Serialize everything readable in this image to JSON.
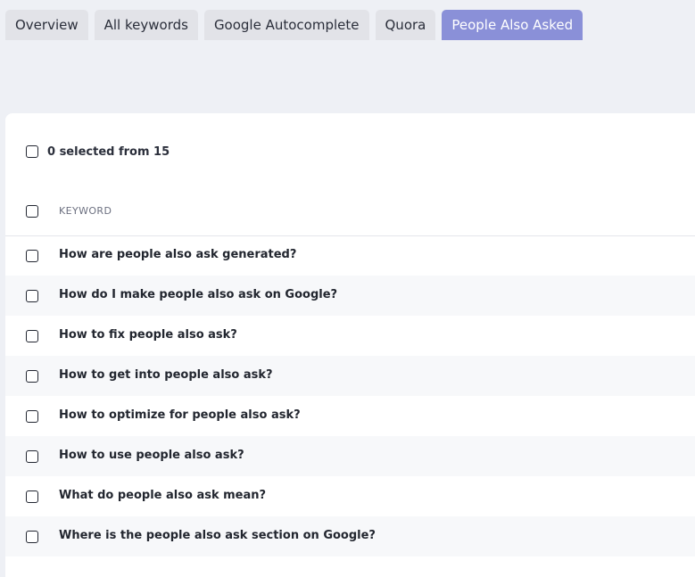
{
  "tabs": [
    {
      "label": "Overview",
      "active": false
    },
    {
      "label": "All keywords",
      "active": false
    },
    {
      "label": "Google Autocomplete",
      "active": false
    },
    {
      "label": "Quora",
      "active": false
    },
    {
      "label": "People Also Asked",
      "active": true
    }
  ],
  "selection": {
    "summary": "0 selected from 15",
    "selected_count": 0,
    "total": 15
  },
  "table": {
    "column_header": "KEYWORD",
    "rows": [
      {
        "keyword": "How are people also ask generated?",
        "checked": false
      },
      {
        "keyword": "How do I make people also ask on Google?",
        "checked": false
      },
      {
        "keyword": "How to fix people also ask?",
        "checked": false
      },
      {
        "keyword": "How to get into people also ask?",
        "checked": false
      },
      {
        "keyword": "How to optimize for people also ask?",
        "checked": false
      },
      {
        "keyword": "How to use people also ask?",
        "checked": false
      },
      {
        "keyword": "What do people also ask mean?",
        "checked": false
      },
      {
        "keyword": "Where is the people also ask section on Google?",
        "checked": false
      }
    ]
  },
  "colors": {
    "page_background": "#eef0f5",
    "tab_inactive": "#e2e3e8",
    "tab_active": "#8a90d8",
    "row_alt": "#f7f8fa"
  }
}
